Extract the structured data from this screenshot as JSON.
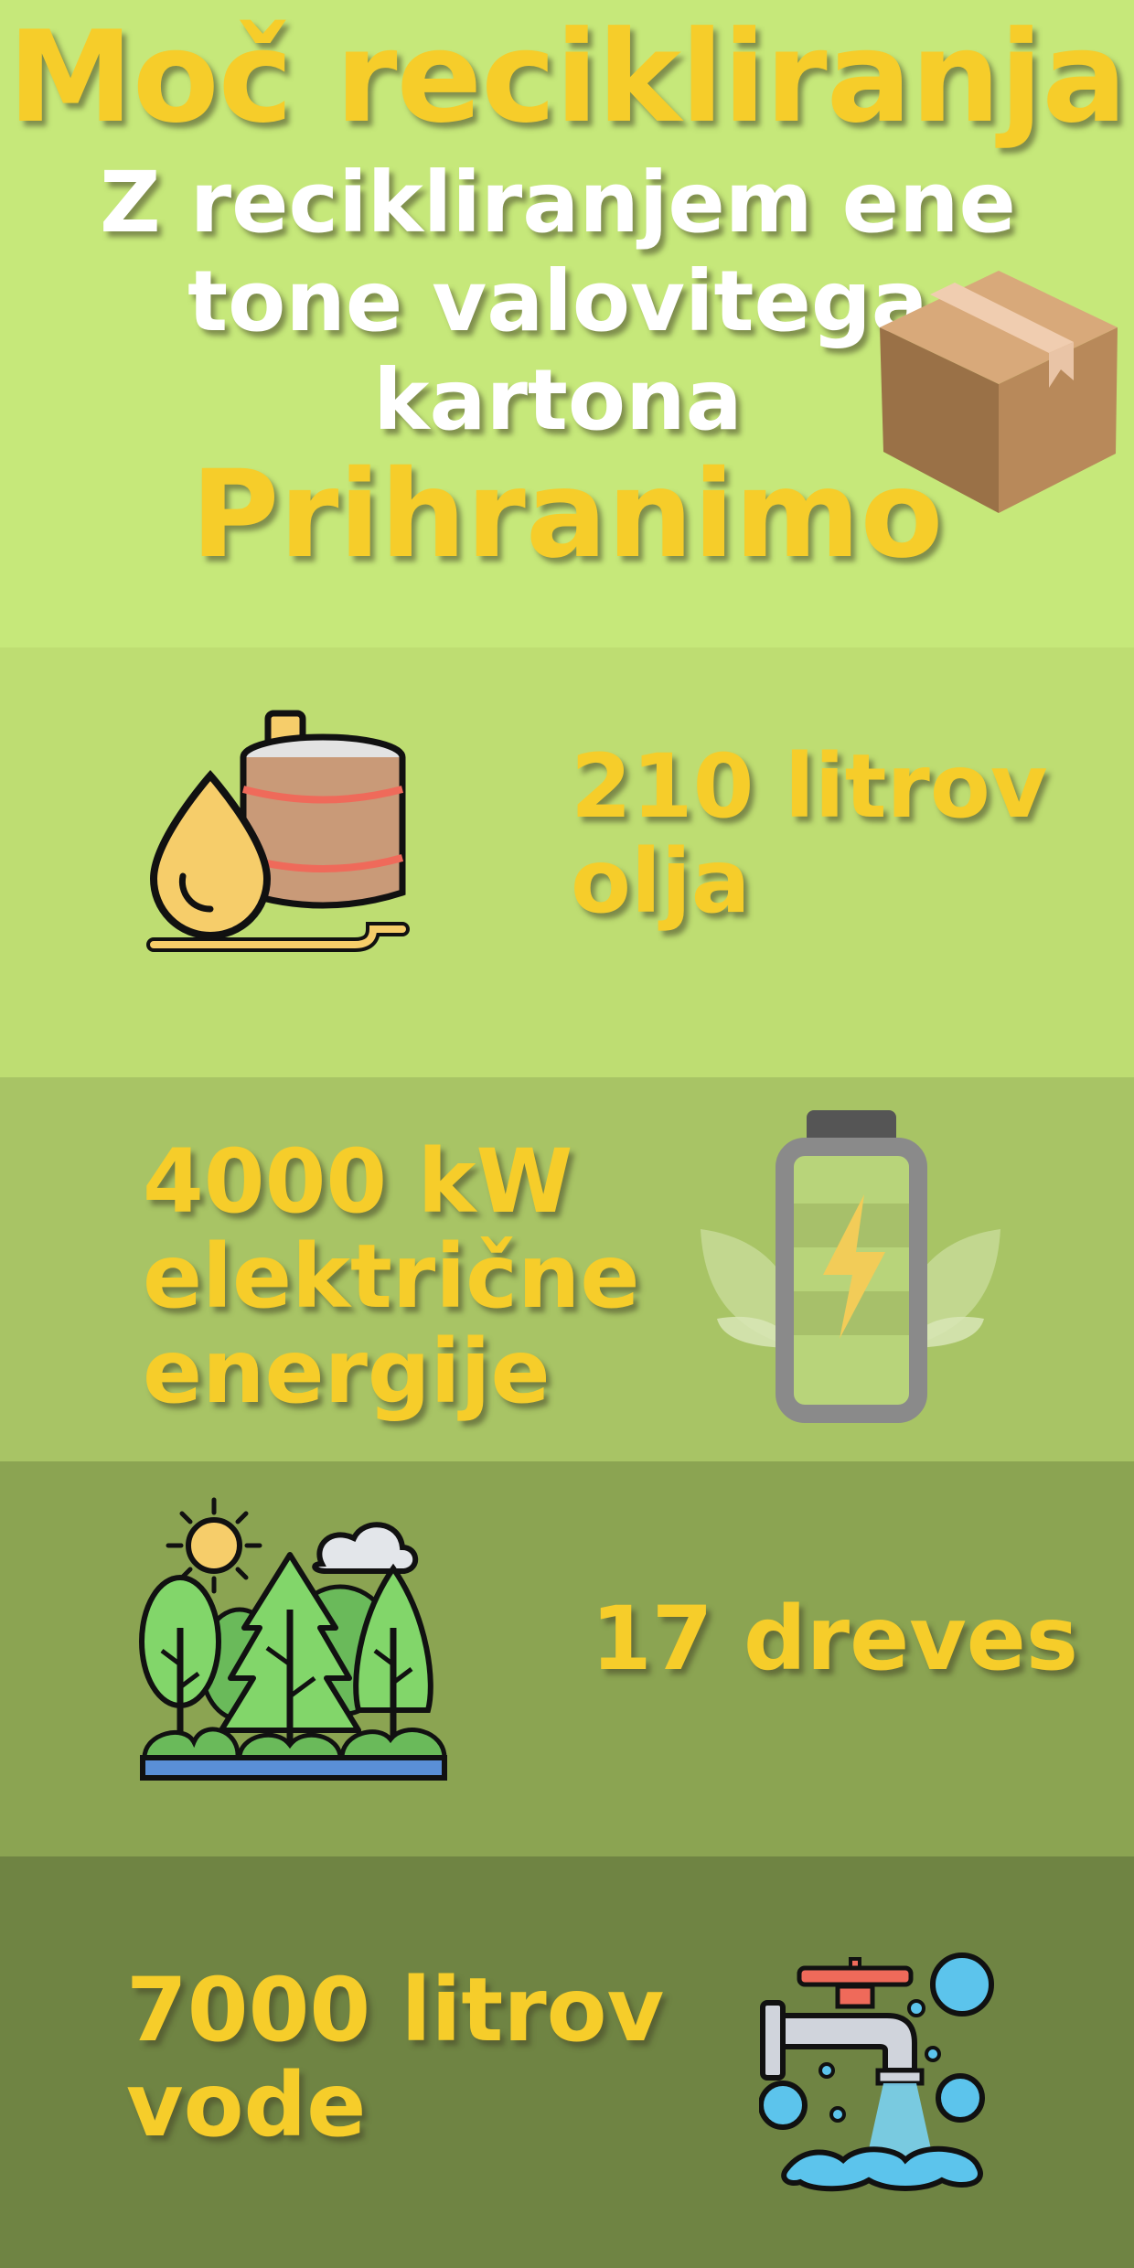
{
  "header": {
    "title": "Moč recikliranja",
    "subtitle_lines": [
      "Z recikliranjem ene",
      "tone valovitega",
      "kartona"
    ],
    "action": "Prihranimo"
  },
  "stats": [
    {
      "lines": [
        "210 litrov",
        "olja"
      ],
      "icon": "oil-barrel-icon"
    },
    {
      "lines": [
        "4000 kW",
        "električne",
        "energije"
      ],
      "icon": "battery-icon"
    },
    {
      "lines": [
        "17 dreves"
      ],
      "icon": "trees-icon"
    },
    {
      "lines": [
        "7000 litrov",
        "vode"
      ],
      "icon": "water-tap-icon"
    }
  ],
  "colors": {
    "accent_text": "#f6cd2a",
    "band_1": "#c6e87a",
    "band_2": "#bedd72",
    "band_3": "#a8c465",
    "band_4": "#8ba452",
    "band_5": "#6f8443"
  }
}
